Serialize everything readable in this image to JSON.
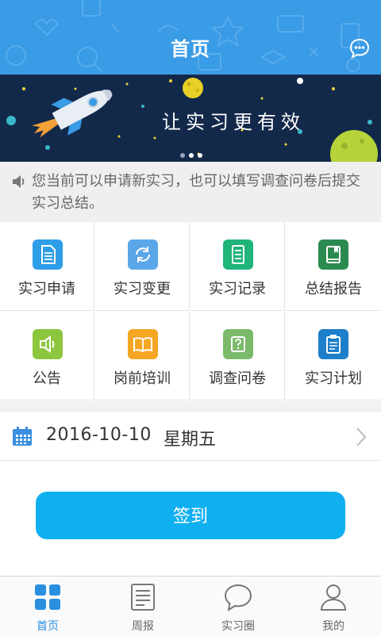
{
  "header": {
    "title": "首页"
  },
  "banner": {
    "slogan": "让实习更有效"
  },
  "notice": {
    "text": "您当前可以申请新实习，也可以填写调查问卷后提交实习总结。"
  },
  "grid": [
    {
      "label": "实习申请",
      "icon": "document-icon",
      "color": "#2e9ee8"
    },
    {
      "label": "实习变更",
      "icon": "refresh-icon",
      "color": "#5ba6e8"
    },
    {
      "label": "实习记录",
      "icon": "list-icon",
      "color": "#1fb57a"
    },
    {
      "label": "总结报告",
      "icon": "book-icon",
      "color": "#2b8a4f"
    },
    {
      "label": "公告",
      "icon": "speaker-icon",
      "color": "#8cc63f"
    },
    {
      "label": "岗前培训",
      "icon": "open-book-icon",
      "color": "#f5a623"
    },
    {
      "label": "调查问卷",
      "icon": "question-icon",
      "color": "#7aba6a"
    },
    {
      "label": "实习计划",
      "icon": "clipboard-icon",
      "color": "#1d7ec9"
    }
  ],
  "date_row": {
    "date": "2016-10-10",
    "weekday": "星期五"
  },
  "sign_button": {
    "label": "签到"
  },
  "tabs": [
    {
      "label": "首页",
      "icon": "home-grid-icon",
      "active": true
    },
    {
      "label": "周报",
      "icon": "report-icon",
      "active": false
    },
    {
      "label": "实习圈",
      "icon": "chat-bubble-icon",
      "active": false
    },
    {
      "label": "我的",
      "icon": "user-icon",
      "active": false
    }
  ],
  "colors": {
    "header": "#3a9be6",
    "accent": "#10b0f0",
    "active_tab": "#2b8fe0"
  }
}
